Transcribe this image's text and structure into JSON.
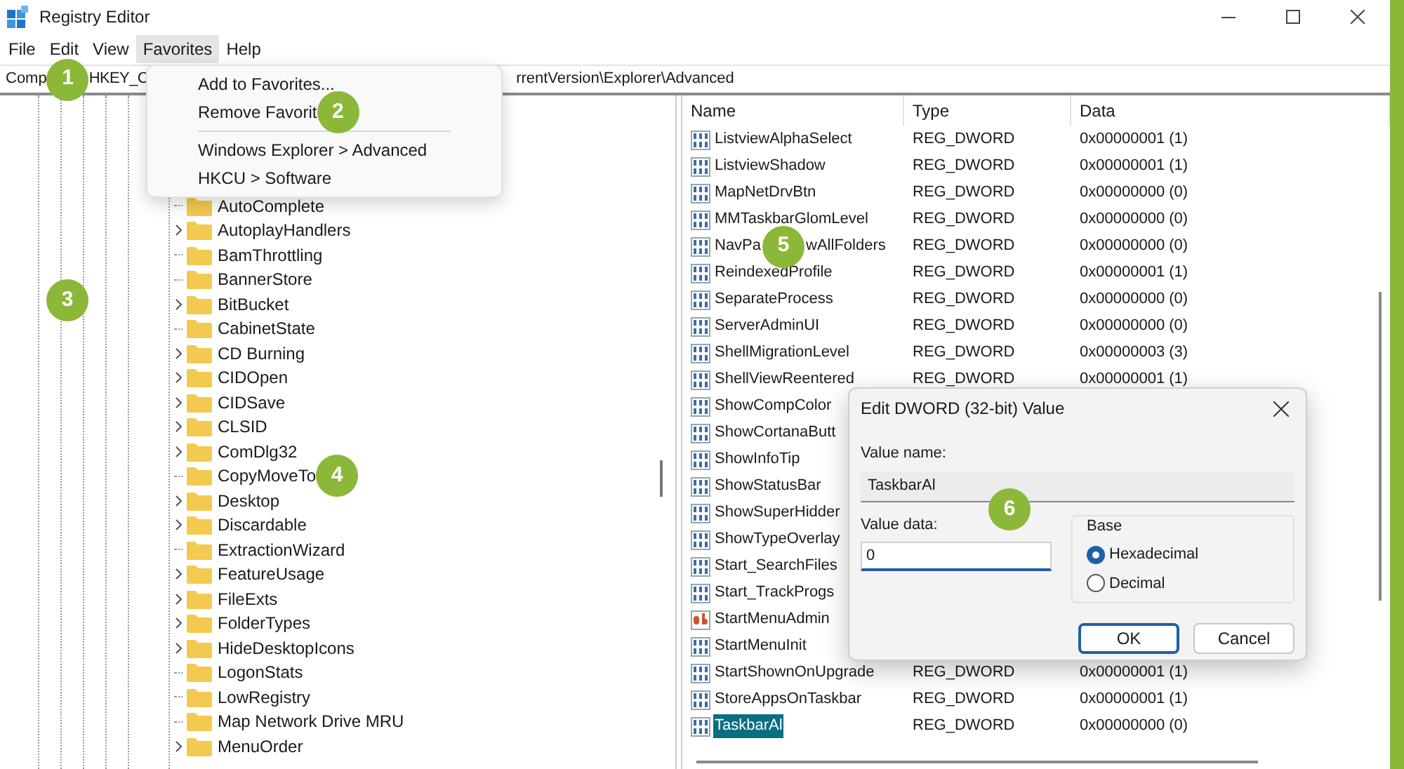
{
  "window": {
    "title": "Registry Editor"
  },
  "menu_bar": [
    {
      "label": "File",
      "selected": false
    },
    {
      "label": "Edit",
      "selected": false
    },
    {
      "label": "View",
      "selected": false
    },
    {
      "label": "Favorites",
      "selected": true
    },
    {
      "label": "Help",
      "selected": false
    }
  ],
  "address_bar": {
    "parts": [
      "Comp",
      "HKEY_C",
      "rrentVersion\\Explorer\\Advanced"
    ],
    "callout": "1"
  },
  "favorites_menu": {
    "items": [
      {
        "kind": "item",
        "label": "Add to Favorites..."
      },
      {
        "kind": "item",
        "label": "Remove Favorit",
        "callout": "2"
      },
      {
        "kind": "separator"
      },
      {
        "kind": "item",
        "label": "Windows Explorer > Advanced"
      },
      {
        "kind": "item",
        "label": "HKCU > Software"
      }
    ]
  },
  "tree": {
    "items": [
      {
        "label": "AutoComplete",
        "has_children": false
      },
      {
        "label": "AutoplayHandlers",
        "has_children": true
      },
      {
        "label": "BamThrottling",
        "has_children": false
      },
      {
        "label": "BannerStore",
        "has_children": false
      },
      {
        "label": "BitBucket",
        "has_children": true
      },
      {
        "label": "CabinetState",
        "has_children": false
      },
      {
        "label": "CD Burning",
        "has_children": true
      },
      {
        "label": "CIDOpen",
        "has_children": true
      },
      {
        "label": "CIDSave",
        "has_children": true
      },
      {
        "label": "CLSID",
        "has_children": true
      },
      {
        "label": "ComDlg32",
        "has_children": true
      },
      {
        "label": "CopyMoveTo",
        "has_children": false,
        "callout": "4"
      },
      {
        "label": "Desktop",
        "has_children": true
      },
      {
        "label": "Discardable",
        "has_children": true
      },
      {
        "label": "ExtractionWizard",
        "has_children": false
      },
      {
        "label": "FeatureUsage",
        "has_children": true
      },
      {
        "label": "FileExts",
        "has_children": true
      },
      {
        "label": "FolderTypes",
        "has_children": true
      },
      {
        "label": "HideDesktopIcons",
        "has_children": true
      },
      {
        "label": "LogonStats",
        "has_children": false
      },
      {
        "label": "LowRegistry",
        "has_children": false
      },
      {
        "label": "Map Network Drive MRU",
        "has_children": false
      },
      {
        "label": "MenuOrder",
        "has_children": true
      }
    ]
  },
  "values_table": {
    "columns": [
      "Name",
      "Type",
      "Data"
    ],
    "rows": [
      {
        "kind": "dword",
        "name_parts": [
          "ListviewAlphaSelect"
        ],
        "type": "REG_DWORD",
        "data": "0x00000001 (1)",
        "selected": false
      },
      {
        "kind": "dword",
        "name_parts": [
          "ListviewShadow"
        ],
        "type": "REG_DWORD",
        "data": "0x00000001 (1)",
        "selected": false
      },
      {
        "kind": "dword",
        "name_parts": [
          "MapNetDrvBtn"
        ],
        "type": "REG_DWORD",
        "data": "0x00000000 (0)",
        "selected": false
      },
      {
        "kind": "dword",
        "name_parts": [
          "MMTaskbarGlomLevel"
        ],
        "type": "REG_DWORD",
        "data": "0x00000000 (0)",
        "selected": false
      },
      {
        "kind": "dword",
        "name_parts": [
          "NavPa",
          "wAllFolders"
        ],
        "callout": "5",
        "type": "REG_DWORD",
        "data": "0x00000000 (0)",
        "selected": false
      },
      {
        "kind": "dword",
        "name_parts": [
          "ReindexedProfile"
        ],
        "type": "REG_DWORD",
        "data": "0x00000001 (1)",
        "selected": false
      },
      {
        "kind": "dword",
        "name_parts": [
          "SeparateProcess"
        ],
        "type": "REG_DWORD",
        "data": "0x00000000 (0)",
        "selected": false
      },
      {
        "kind": "dword",
        "name_parts": [
          "ServerAdminUI"
        ],
        "type": "REG_DWORD",
        "data": "0x00000000 (0)",
        "selected": false
      },
      {
        "kind": "dword",
        "name_parts": [
          "ShellMigrationLevel"
        ],
        "type": "REG_DWORD",
        "data": "0x00000003 (3)",
        "selected": false
      },
      {
        "kind": "dword",
        "name_parts": [
          "ShellViewReentered"
        ],
        "type": "REG_DWORD",
        "data": "0x00000001 (1)",
        "selected": false
      },
      {
        "kind": "dword",
        "name_parts": [
          "ShowCompColor"
        ],
        "selected": false
      },
      {
        "kind": "dword",
        "name_parts": [
          "ShowCortanaButt"
        ],
        "selected": false
      },
      {
        "kind": "dword",
        "name_parts": [
          "ShowInfoTip"
        ],
        "selected": false
      },
      {
        "kind": "dword",
        "name_parts": [
          "ShowStatusBar"
        ],
        "selected": false
      },
      {
        "kind": "dword",
        "name_parts": [
          "ShowSuperHidder"
        ],
        "selected": false
      },
      {
        "kind": "dword",
        "name_parts": [
          "ShowTypeOverlay"
        ],
        "selected": false
      },
      {
        "kind": "dword",
        "name_parts": [
          "Start_SearchFiles"
        ],
        "selected": false
      },
      {
        "kind": "dword",
        "name_parts": [
          "Start_TrackProgs"
        ],
        "selected": false
      },
      {
        "kind": "string",
        "name_parts": [
          "StartMenuAdmin"
        ],
        "selected": false
      },
      {
        "kind": "dword",
        "name_parts": [
          "StartMenuInit"
        ],
        "selected": false
      },
      {
        "kind": "dword",
        "name_parts": [
          "StartShownOnUpgrade"
        ],
        "type": "REG_DWORD",
        "data": "0x00000001 (1)",
        "selected": false
      },
      {
        "kind": "dword",
        "name_parts": [
          "StoreAppsOnTaskbar"
        ],
        "type": "REG_DWORD",
        "data": "0x00000001 (1)",
        "selected": false
      },
      {
        "kind": "dword",
        "name_parts": [
          "TaskbarAl"
        ],
        "type": "REG_DWORD",
        "data": "0x00000000 (0)",
        "selected": true
      }
    ]
  },
  "dialog": {
    "title": "Edit DWORD (32-bit) Value",
    "value_name_label": "Value name:",
    "value_name": "TaskbarAl",
    "value_data_label": "Value data:",
    "value_data": "0",
    "base_label": "Base",
    "base_options": [
      {
        "label": "Hexadecimal",
        "selected": true
      },
      {
        "label": "Decimal",
        "selected": false
      }
    ],
    "buttons": [
      {
        "label": "OK",
        "default": true
      },
      {
        "label": "Cancel",
        "default": false
      }
    ]
  },
  "callouts": [
    "3",
    "6"
  ]
}
